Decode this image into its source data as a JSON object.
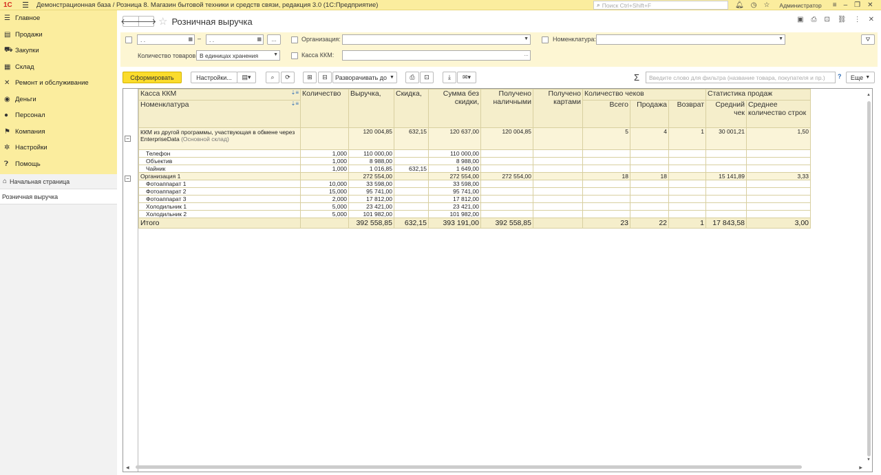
{
  "titlebar": {
    "logo": "1С",
    "title": "Демонстрационная база / Розница 8. Магазин бытовой техники и средств связи, редакция 3.0  (1С:Предприятие)",
    "search_placeholder": "Поиск Ctrl+Shift+F",
    "user": "Администратор"
  },
  "sidebar": {
    "items": [
      {
        "icon": "menu-icon",
        "label": "Главное"
      },
      {
        "icon": "cart-icon",
        "label": "Продажи"
      },
      {
        "icon": "purchase-icon",
        "label": "Закупки"
      },
      {
        "icon": "warehouse-icon",
        "label": "Склад"
      },
      {
        "icon": "wrench-icon",
        "label": "Ремонт и обслуживание"
      },
      {
        "icon": "money-icon",
        "label": "Деньги"
      },
      {
        "icon": "person-icon",
        "label": "Персонал"
      },
      {
        "icon": "flag-icon",
        "label": "Компания"
      },
      {
        "icon": "gear-icon",
        "label": "Настройки"
      },
      {
        "icon": "help-icon",
        "label": "Помощь"
      }
    ],
    "home": "Начальная страница",
    "active": "Розничная выручка"
  },
  "page": {
    "title": "Розничная выручка"
  },
  "filters": {
    "date_from": " .  .",
    "date_to": " .  .",
    "dash": "–",
    "more": "...",
    "org_label": "Организация:",
    "org_value": "",
    "nom_label": "Номенклатура:",
    "nom_value": "",
    "qty_label": "Количество товаров:",
    "qty_value": "В единицах хранения",
    "kkm_label": "Касса ККМ:",
    "kkm_value": ""
  },
  "toolbar": {
    "generate": "Сформировать",
    "settings": "Настройки...",
    "expand": "Разворачивать до",
    "filter_placeholder": "Введите слово для фильтра (название товара, покупателя и пр.)",
    "sigma": "Σ",
    "help": "?",
    "more": "Еще"
  },
  "report": {
    "headers": {
      "kkm": "Касса ККМ",
      "nomenclature": "Номенклатура",
      "qty": "Количество",
      "revenue": "Выручка,",
      "discount": "Скидка,",
      "sum_no_disc": "Сумма без скидки,",
      "cash": "Получено наличными",
      "card": "Получено картами",
      "checks": "Количество чеков",
      "checks_all": "Всего",
      "checks_sale": "Продажа",
      "checks_ret": "Возврат",
      "stats": "Статистика продаж",
      "avg_check": "Средний чек",
      "avg_rows": "Среднее количество строк"
    },
    "group1": {
      "name": "ККМ из другой программы, участвующая в обмене через EnterpriseData",
      "warehouse": "(Основной склад)",
      "revenue": "120 004,85",
      "discount": "632,15",
      "sum": "120 637,00",
      "cash": "120 004,85",
      "all": "5",
      "sale": "4",
      "ret": "1",
      "avg": "30 001,21",
      "rows": "1,50"
    },
    "group1_items": [
      {
        "name": "Телефон",
        "qty": "1,000",
        "revenue": "110 000,00",
        "discount": "",
        "sum": "110 000,00"
      },
      {
        "name": "Объектив",
        "qty": "1,000",
        "revenue": "8 988,00",
        "discount": "",
        "sum": "8 988,00"
      },
      {
        "name": "Чайник",
        "qty": "1,000",
        "revenue": "1 016,85",
        "discount": "632,15",
        "sum": "1 649,00"
      }
    ],
    "group2": {
      "name": "Организация 1",
      "revenue": "272 554,00",
      "sum": "272 554,00",
      "cash": "272 554,00",
      "all": "18",
      "sale": "18",
      "avg": "15 141,89",
      "rows": "3,33"
    },
    "group2_items": [
      {
        "name": "Фотоаппарат 1",
        "qty": "10,000",
        "revenue": "33 598,00",
        "sum": "33 598,00"
      },
      {
        "name": "Фотоаппарат 2",
        "qty": "15,000",
        "revenue": "95 741,00",
        "sum": "95 741,00"
      },
      {
        "name": "Фотоаппарат 3",
        "qty": "2,000",
        "revenue": "17 812,00",
        "sum": "17 812,00"
      },
      {
        "name": "Холодильник 1",
        "qty": "5,000",
        "revenue": "23 421,00",
        "sum": "23 421,00"
      },
      {
        "name": "Холодильник 2",
        "qty": "5,000",
        "revenue": "101 982,00",
        "sum": "101 982,00"
      }
    ],
    "total": {
      "name": "Итого",
      "revenue": "392 558,85",
      "discount": "632,15",
      "sum": "393 191,00",
      "cash": "392 558,85",
      "all": "23",
      "sale": "22",
      "ret": "1",
      "avg": "17 843,58",
      "rows": "3,00"
    }
  }
}
